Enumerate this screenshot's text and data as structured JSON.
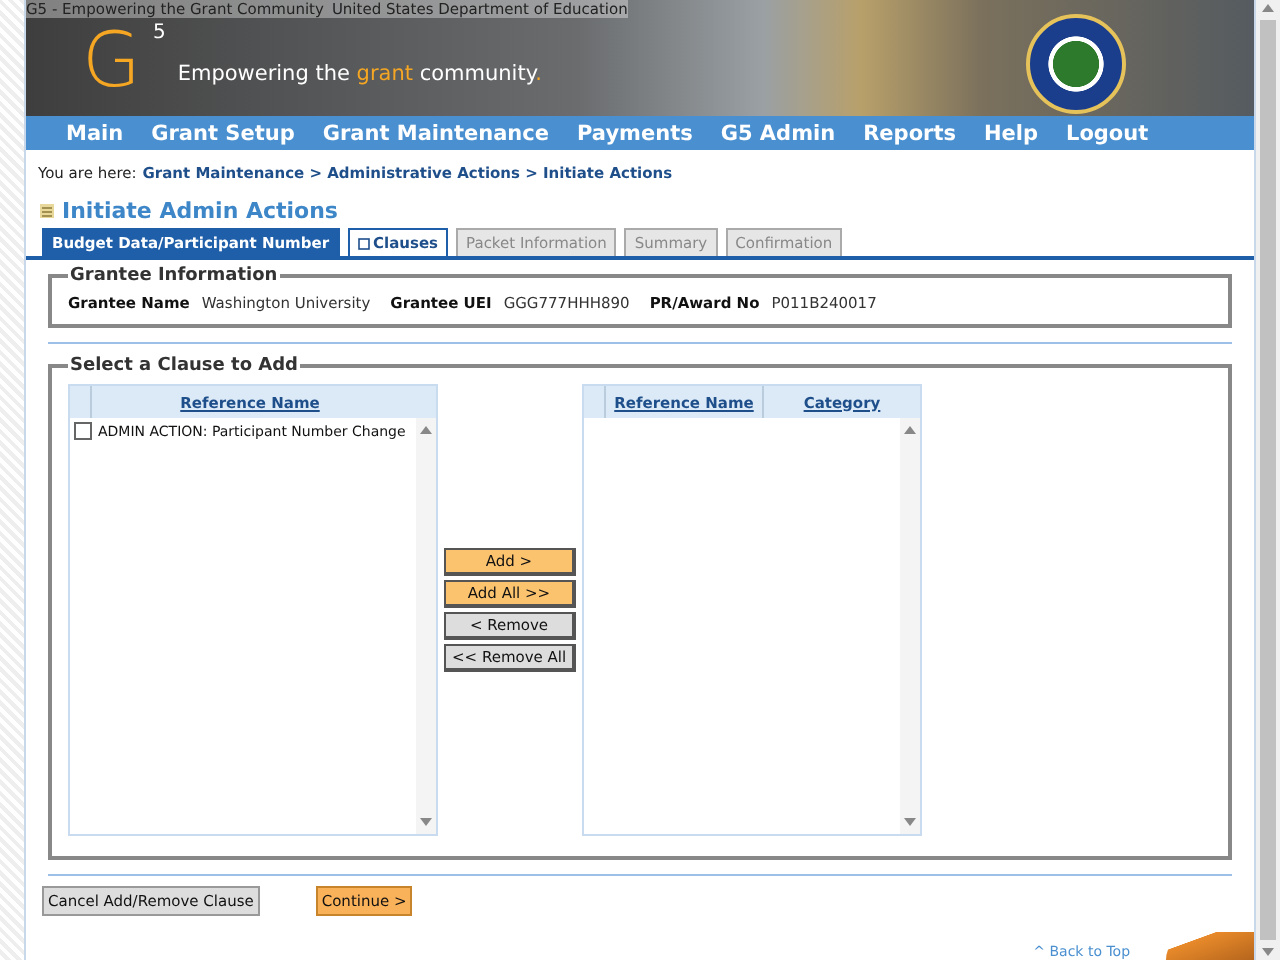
{
  "banner": {
    "alt_texts": [
      "G5 - Empowering the Grant Community",
      "United States Department of Education"
    ],
    "logo_letter": "G",
    "logo_superscript": "5",
    "tagline": [
      "Empowering the ",
      "grant",
      " community",
      "."
    ]
  },
  "nav": [
    "Main",
    "Grant Setup",
    "Grant Maintenance",
    "Payments",
    "G5 Admin",
    "Reports",
    "Help",
    "Logout"
  ],
  "breadcrumb": {
    "label": "You are here:",
    "path": "Grant Maintenance > Administrative Actions > Initiate Actions"
  },
  "title": "Initiate Admin Actions",
  "tabs": [
    {
      "label": "Budget Data/Participant Number",
      "selected": false,
      "disabled": false
    },
    {
      "label": "Clauses",
      "selected": true,
      "disabled": false
    },
    {
      "label": "Packet Information",
      "selected": false,
      "disabled": true
    },
    {
      "label": "Summary",
      "selected": false,
      "disabled": true
    },
    {
      "label": "Confirmation",
      "selected": false,
      "disabled": true
    }
  ],
  "grantee": {
    "legend": "Grantee Information",
    "fields": [
      {
        "label": "Grantee Name",
        "value": "Washington University"
      },
      {
        "label": "Grantee UEI",
        "value": "GGG777HHH890"
      },
      {
        "label": "PR/Award No",
        "value": "P011B240017"
      }
    ]
  },
  "clauses": {
    "legend": "Select a Clause to Add",
    "available": {
      "columns": [
        "Reference Name"
      ],
      "rows": [
        {
          "name": "ADMIN ACTION: Participant Number Change",
          "checked": false
        }
      ]
    },
    "buttons": [
      {
        "label": "Add >",
        "kind": "primary"
      },
      {
        "label": "Add All >>",
        "kind": "primary"
      },
      {
        "label": "< Remove",
        "kind": "secondary"
      },
      {
        "label": "<< Remove All",
        "kind": "secondary"
      }
    ],
    "selected": {
      "columns": [
        "Reference Name",
        "Category"
      ]
    }
  },
  "footer_buttons": [
    {
      "label": "Cancel Add/Remove Clause",
      "kind": "secondary"
    },
    {
      "label": "Continue >",
      "kind": "primary"
    }
  ],
  "back_to_top": "^ Back to Top"
}
